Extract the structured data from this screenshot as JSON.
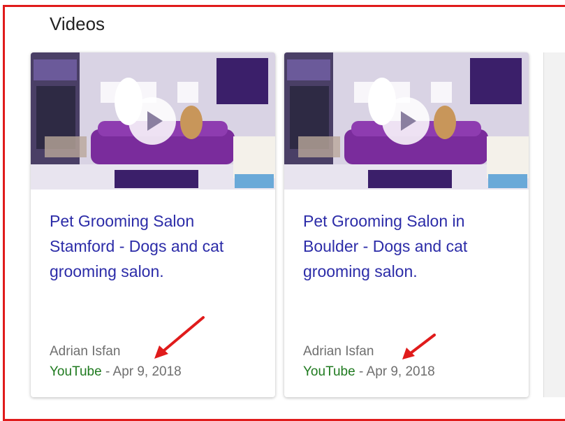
{
  "section": {
    "title": "Videos"
  },
  "videos": [
    {
      "title": "Pet Grooming Salon Stamford - Dogs and cat grooming salon.",
      "author": "Adrian Isfan",
      "source": "YouTube",
      "separator": " - ",
      "date": "Apr 9, 2018"
    },
    {
      "title": "Pet Grooming Salon in Boulder - Dogs and cat grooming salon.",
      "author": "Adrian Isfan",
      "source": "YouTube",
      "separator": " - ",
      "date": "Apr 9, 2018"
    }
  ],
  "colors": {
    "highlight_frame": "#e01b1b",
    "link": "#2c2ca8",
    "source": "#1f7a1f",
    "annotation_arrow": "#e01b1b"
  },
  "icons": {
    "play": "play-icon",
    "annotation": "red-arrow-annotation"
  }
}
